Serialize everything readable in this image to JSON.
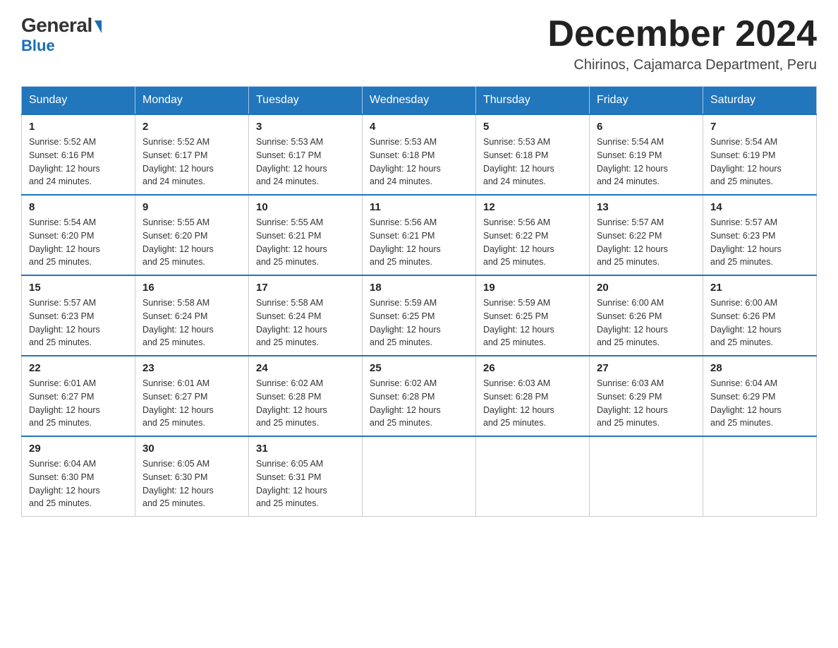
{
  "logo": {
    "general": "General",
    "blue": "Blue"
  },
  "title": "December 2024",
  "location": "Chirinos, Cajamarca Department, Peru",
  "days_of_week": [
    "Sunday",
    "Monday",
    "Tuesday",
    "Wednesday",
    "Thursday",
    "Friday",
    "Saturday"
  ],
  "weeks": [
    [
      {
        "day": "1",
        "sunrise": "5:52 AM",
        "sunset": "6:16 PM",
        "daylight": "12 hours and 24 minutes."
      },
      {
        "day": "2",
        "sunrise": "5:52 AM",
        "sunset": "6:17 PM",
        "daylight": "12 hours and 24 minutes."
      },
      {
        "day": "3",
        "sunrise": "5:53 AM",
        "sunset": "6:17 PM",
        "daylight": "12 hours and 24 minutes."
      },
      {
        "day": "4",
        "sunrise": "5:53 AM",
        "sunset": "6:18 PM",
        "daylight": "12 hours and 24 minutes."
      },
      {
        "day": "5",
        "sunrise": "5:53 AM",
        "sunset": "6:18 PM",
        "daylight": "12 hours and 24 minutes."
      },
      {
        "day": "6",
        "sunrise": "5:54 AM",
        "sunset": "6:19 PM",
        "daylight": "12 hours and 24 minutes."
      },
      {
        "day": "7",
        "sunrise": "5:54 AM",
        "sunset": "6:19 PM",
        "daylight": "12 hours and 25 minutes."
      }
    ],
    [
      {
        "day": "8",
        "sunrise": "5:54 AM",
        "sunset": "6:20 PM",
        "daylight": "12 hours and 25 minutes."
      },
      {
        "day": "9",
        "sunrise": "5:55 AM",
        "sunset": "6:20 PM",
        "daylight": "12 hours and 25 minutes."
      },
      {
        "day": "10",
        "sunrise": "5:55 AM",
        "sunset": "6:21 PM",
        "daylight": "12 hours and 25 minutes."
      },
      {
        "day": "11",
        "sunrise": "5:56 AM",
        "sunset": "6:21 PM",
        "daylight": "12 hours and 25 minutes."
      },
      {
        "day": "12",
        "sunrise": "5:56 AM",
        "sunset": "6:22 PM",
        "daylight": "12 hours and 25 minutes."
      },
      {
        "day": "13",
        "sunrise": "5:57 AM",
        "sunset": "6:22 PM",
        "daylight": "12 hours and 25 minutes."
      },
      {
        "day": "14",
        "sunrise": "5:57 AM",
        "sunset": "6:23 PM",
        "daylight": "12 hours and 25 minutes."
      }
    ],
    [
      {
        "day": "15",
        "sunrise": "5:57 AM",
        "sunset": "6:23 PM",
        "daylight": "12 hours and 25 minutes."
      },
      {
        "day": "16",
        "sunrise": "5:58 AM",
        "sunset": "6:24 PM",
        "daylight": "12 hours and 25 minutes."
      },
      {
        "day": "17",
        "sunrise": "5:58 AM",
        "sunset": "6:24 PM",
        "daylight": "12 hours and 25 minutes."
      },
      {
        "day": "18",
        "sunrise": "5:59 AM",
        "sunset": "6:25 PM",
        "daylight": "12 hours and 25 minutes."
      },
      {
        "day": "19",
        "sunrise": "5:59 AM",
        "sunset": "6:25 PM",
        "daylight": "12 hours and 25 minutes."
      },
      {
        "day": "20",
        "sunrise": "6:00 AM",
        "sunset": "6:26 PM",
        "daylight": "12 hours and 25 minutes."
      },
      {
        "day": "21",
        "sunrise": "6:00 AM",
        "sunset": "6:26 PM",
        "daylight": "12 hours and 25 minutes."
      }
    ],
    [
      {
        "day": "22",
        "sunrise": "6:01 AM",
        "sunset": "6:27 PM",
        "daylight": "12 hours and 25 minutes."
      },
      {
        "day": "23",
        "sunrise": "6:01 AM",
        "sunset": "6:27 PM",
        "daylight": "12 hours and 25 minutes."
      },
      {
        "day": "24",
        "sunrise": "6:02 AM",
        "sunset": "6:28 PM",
        "daylight": "12 hours and 25 minutes."
      },
      {
        "day": "25",
        "sunrise": "6:02 AM",
        "sunset": "6:28 PM",
        "daylight": "12 hours and 25 minutes."
      },
      {
        "day": "26",
        "sunrise": "6:03 AM",
        "sunset": "6:28 PM",
        "daylight": "12 hours and 25 minutes."
      },
      {
        "day": "27",
        "sunrise": "6:03 AM",
        "sunset": "6:29 PM",
        "daylight": "12 hours and 25 minutes."
      },
      {
        "day": "28",
        "sunrise": "6:04 AM",
        "sunset": "6:29 PM",
        "daylight": "12 hours and 25 minutes."
      }
    ],
    [
      {
        "day": "29",
        "sunrise": "6:04 AM",
        "sunset": "6:30 PM",
        "daylight": "12 hours and 25 minutes."
      },
      {
        "day": "30",
        "sunrise": "6:05 AM",
        "sunset": "6:30 PM",
        "daylight": "12 hours and 25 minutes."
      },
      {
        "day": "31",
        "sunrise": "6:05 AM",
        "sunset": "6:31 PM",
        "daylight": "12 hours and 25 minutes."
      },
      null,
      null,
      null,
      null
    ]
  ],
  "labels": {
    "sunrise": "Sunrise:",
    "sunset": "Sunset:",
    "daylight": "Daylight:"
  }
}
